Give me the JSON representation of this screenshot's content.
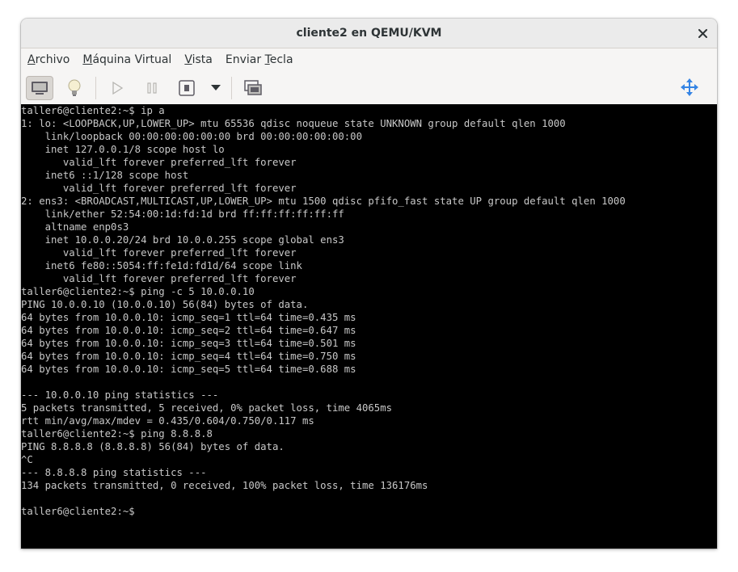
{
  "window": {
    "title": "cliente2 en QEMU/KVM"
  },
  "menu": [
    {
      "pre": "",
      "ul": "A",
      "post": "rchivo"
    },
    {
      "pre": "",
      "ul": "M",
      "post": "áquina Virtual"
    },
    {
      "pre": "",
      "ul": "V",
      "post": "ista"
    },
    {
      "pre": "Enviar ",
      "ul": "T",
      "post": "ecla"
    }
  ],
  "toolbar": {
    "icons": [
      "monitor-icon",
      "lightbulb-icon",
      "play-icon",
      "pause-icon",
      "power-icon",
      "dropdown-arrow-icon",
      "screenshot-icon",
      "resize-icon"
    ]
  },
  "console": {
    "lines": [
      "taller6@cliente2:~$ ip a",
      "1: lo: <LOOPBACK,UP,LOWER_UP> mtu 65536 qdisc noqueue state UNKNOWN group default qlen 1000",
      "    link/loopback 00:00:00:00:00:00 brd 00:00:00:00:00:00",
      "    inet 127.0.0.1/8 scope host lo",
      "       valid_lft forever preferred_lft forever",
      "    inet6 ::1/128 scope host",
      "       valid_lft forever preferred_lft forever",
      "2: ens3: <BROADCAST,MULTICAST,UP,LOWER_UP> mtu 1500 qdisc pfifo_fast state UP group default qlen 1000",
      "    link/ether 52:54:00:1d:fd:1d brd ff:ff:ff:ff:ff:ff",
      "    altname enp0s3",
      "    inet 10.0.0.20/24 brd 10.0.0.255 scope global ens3",
      "       valid_lft forever preferred_lft forever",
      "    inet6 fe80::5054:ff:fe1d:fd1d/64 scope link",
      "       valid_lft forever preferred_lft forever",
      "taller6@cliente2:~$ ping -c 5 10.0.0.10",
      "PING 10.0.0.10 (10.0.0.10) 56(84) bytes of data.",
      "64 bytes from 10.0.0.10: icmp_seq=1 ttl=64 time=0.435 ms",
      "64 bytes from 10.0.0.10: icmp_seq=2 ttl=64 time=0.647 ms",
      "64 bytes from 10.0.0.10: icmp_seq=3 ttl=64 time=0.501 ms",
      "64 bytes from 10.0.0.10: icmp_seq=4 ttl=64 time=0.750 ms",
      "64 bytes from 10.0.0.10: icmp_seq=5 ttl=64 time=0.688 ms",
      "",
      "--- 10.0.0.10 ping statistics ---",
      "5 packets transmitted, 5 received, 0% packet loss, time 4065ms",
      "rtt min/avg/max/mdev = 0.435/0.604/0.750/0.117 ms",
      "taller6@cliente2:~$ ping 8.8.8.8",
      "PING 8.8.8.8 (8.8.8.8) 56(84) bytes of data.",
      "^C",
      "--- 8.8.8.8 ping statistics ---",
      "134 packets transmitted, 0 received, 100% packet loss, time 136176ms",
      "",
      "taller6@cliente2:~$"
    ]
  },
  "colors": {
    "console_bg": "#000000",
    "console_fg": "#c8c8c8",
    "titlebar_bg": "#ebebeb"
  }
}
